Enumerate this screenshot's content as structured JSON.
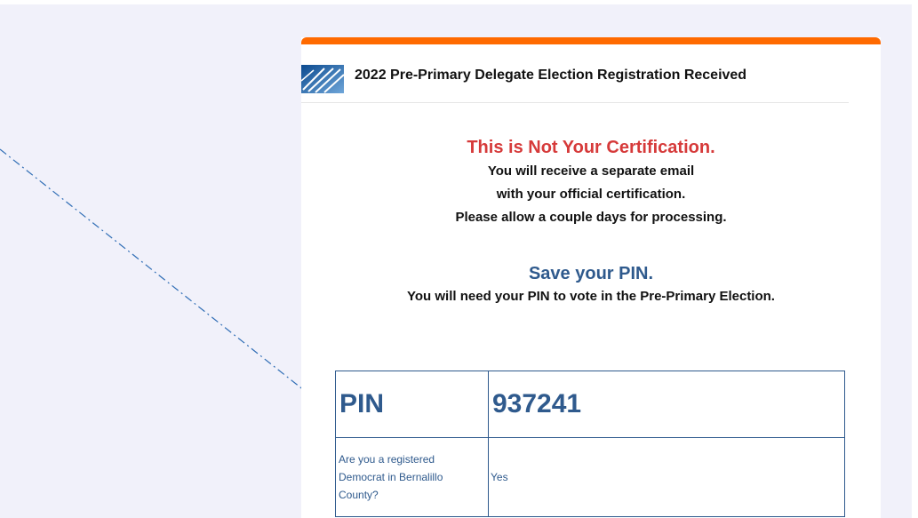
{
  "email": {
    "header_title": "2022 Pre-Primary Delegate Election Registration Received",
    "notice": {
      "title": "This is Not Your Certification.",
      "lines": [
        "You will receive a separate email",
        "with your official certification.",
        "Please allow a couple days for processing."
      ]
    },
    "pin_section": {
      "title": "Save your PIN.",
      "note": "You will need your PIN to vote in the Pre-Primary Election."
    },
    "table": {
      "rows": [
        {
          "label": "PIN",
          "value": "937241"
        },
        {
          "label": "Are you a registered Democrat in Bernalillo County?",
          "value": "Yes"
        }
      ]
    }
  },
  "colors": {
    "accent_orange": "#ff6a00",
    "warning_red": "#d63a3a",
    "brand_blue": "#2f5a8d",
    "page_background": "#f1f1fa"
  },
  "icons": {
    "logo": "organization-logo-icon"
  }
}
